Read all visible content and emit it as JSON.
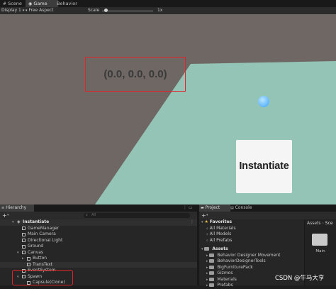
{
  "top_tabs": [
    "Scene",
    "Game",
    "Behavior Designer"
  ],
  "game_toolbar": {
    "display": "Display 1",
    "aspect": "Free Aspect",
    "scale_label": "Scale",
    "scale_value": "1x",
    "scale_level": 0.05
  },
  "game_view": {
    "coordinates_text": "(0.0, 0.0, 0.0)",
    "button_label": "Instantiate"
  },
  "hierarchy": {
    "tab": "Hierarchy",
    "add_label": "+",
    "search_placeholder": "All",
    "scene_name": "Instantiate",
    "items": [
      {
        "label": "GameManager"
      },
      {
        "label": "Main Camera"
      },
      {
        "label": "Directional Light"
      },
      {
        "label": "Ground"
      },
      {
        "label": "Canvas"
      },
      {
        "label": "Button"
      },
      {
        "label": "TransText"
      },
      {
        "label": "EventSystem"
      },
      {
        "label": "Spawn"
      },
      {
        "label": "Capsule(Clone)"
      }
    ]
  },
  "project": {
    "tabs": [
      "Project",
      "Console"
    ],
    "add_label": "+",
    "favorites_label": "Favorites",
    "favorites": [
      "All Materials",
      "All Models",
      "All Prefabs"
    ],
    "assets_label": "Assets",
    "asset_folders": [
      "Behavior Designer Movement",
      "BehaviorDesignerTools",
      "BigFurniturePack",
      "Gizmos",
      "Materials",
      "Prefabs"
    ],
    "breadcrumb": [
      "Assets",
      "Sce"
    ],
    "grid_item": "Main"
  },
  "watermark": "CSDN @牛马大亨",
  "colors": {
    "highlight_box": "#e0242c",
    "ground": "#94c4b6",
    "background": "#6f6764",
    "sphere": "#5ab4ff"
  }
}
